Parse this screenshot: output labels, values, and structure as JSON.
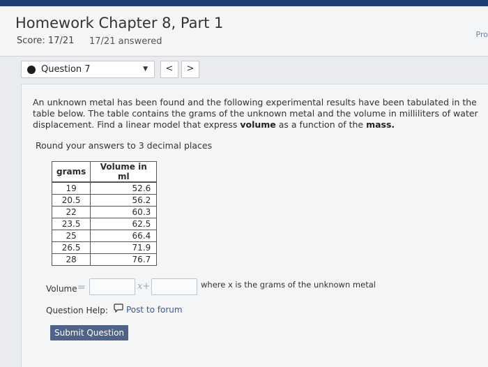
{
  "header": {
    "title": "Homework Chapter 8, Part 1",
    "score": "Score: 17/21",
    "answered": "17/21 answered",
    "right_cut": "Pro"
  },
  "nav": {
    "question_label": "Question 7",
    "caret": "▼",
    "prev": "<",
    "next": ">"
  },
  "question": {
    "prompt_a": "An unknown metal has been found and the following experimental results have been tabulated in the table below. The table contains the grams of the unknown metal and the volume in milliliters of water displacement. Find a linear model that express ",
    "prompt_bold1": "volume",
    "prompt_b": " as a function of the ",
    "prompt_bold2": "mass.",
    "round_note": "Round your answers to 3 decimal places"
  },
  "table": {
    "headers": [
      "grams",
      "Volume in ml"
    ],
    "rows": [
      [
        "19",
        "52.6"
      ],
      [
        "20.5",
        "56.2"
      ],
      [
        "22",
        "60.3"
      ],
      [
        "23.5",
        "62.5"
      ],
      [
        "25",
        "66.4"
      ],
      [
        "26.5",
        "71.9"
      ],
      [
        "28",
        "76.7"
      ]
    ]
  },
  "answer": {
    "volume_label": "Volume",
    "equals": "=",
    "slope_value": "",
    "intercept_value": "",
    "x_plus": "x+",
    "where_text": "where x is the grams of the unknown metal"
  },
  "help": {
    "label": "Question Help:",
    "forum_icon": "speech-bubble-icon",
    "forum_text": "Post to forum"
  },
  "submit_label": "Submit Question"
}
